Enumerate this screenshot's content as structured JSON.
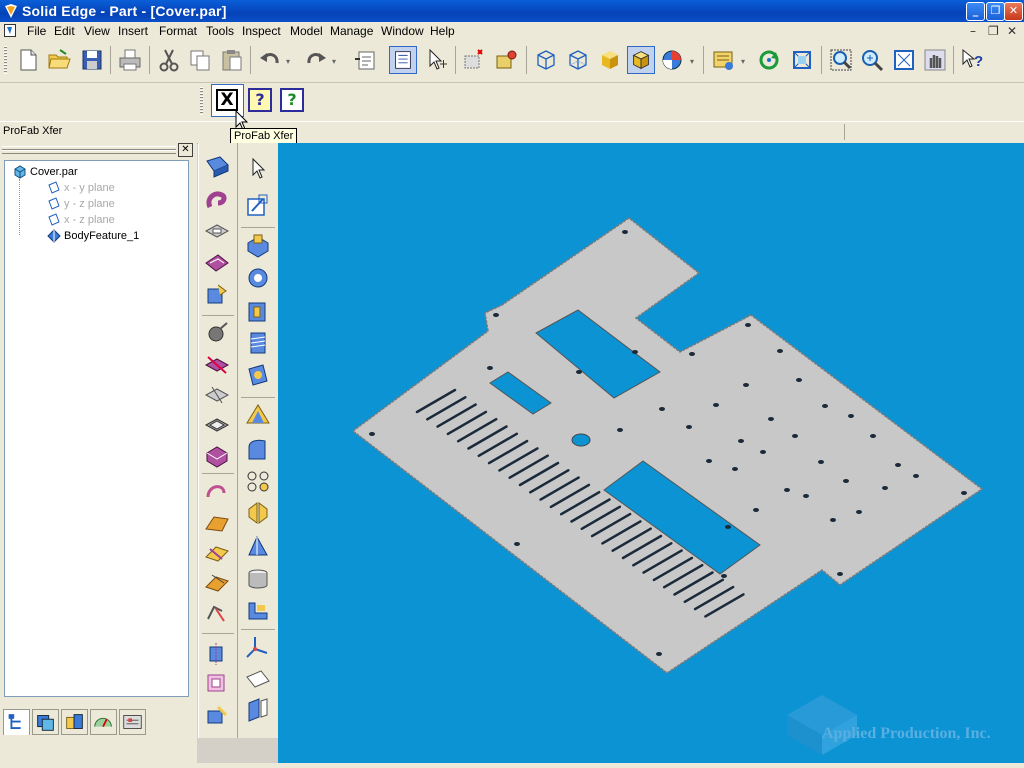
{
  "window": {
    "title": "Solid Edge - Part - [Cover.par]",
    "buttons": {
      "minimize": "_",
      "restore": "❐",
      "close": "✕"
    }
  },
  "menubar": {
    "items": [
      "File",
      "Edit",
      "View",
      "Insert",
      "Format",
      "Tools",
      "Inspect",
      "Model",
      "Manage",
      "Window",
      "Help"
    ],
    "doc_buttons": {
      "minimize": "–",
      "restore": "❐",
      "close": "✕"
    }
  },
  "toolbar2": {
    "xfer_label": "X",
    "help1_label": "?",
    "help2_label": "?"
  },
  "profab": {
    "label": "ProFab Xfer",
    "tooltip": "ProFab Xfer"
  },
  "pathfinder": {
    "close_label": "✕",
    "root": "Cover.par",
    "items": [
      {
        "label": "x - y plane",
        "dimmed": true
      },
      {
        "label": "y - z plane",
        "dimmed": true
      },
      {
        "label": "x - z plane",
        "dimmed": true
      },
      {
        "label": "BodyFeature_1",
        "dimmed": false
      }
    ]
  },
  "viewport": {
    "background": "#0b93d4",
    "part_color": "#c8c8c8",
    "watermark": "Applied Production, Inc."
  },
  "colors": {
    "titlebar": "#0542b8",
    "chrome": "#ece9d8",
    "accent": "#316ac5"
  }
}
